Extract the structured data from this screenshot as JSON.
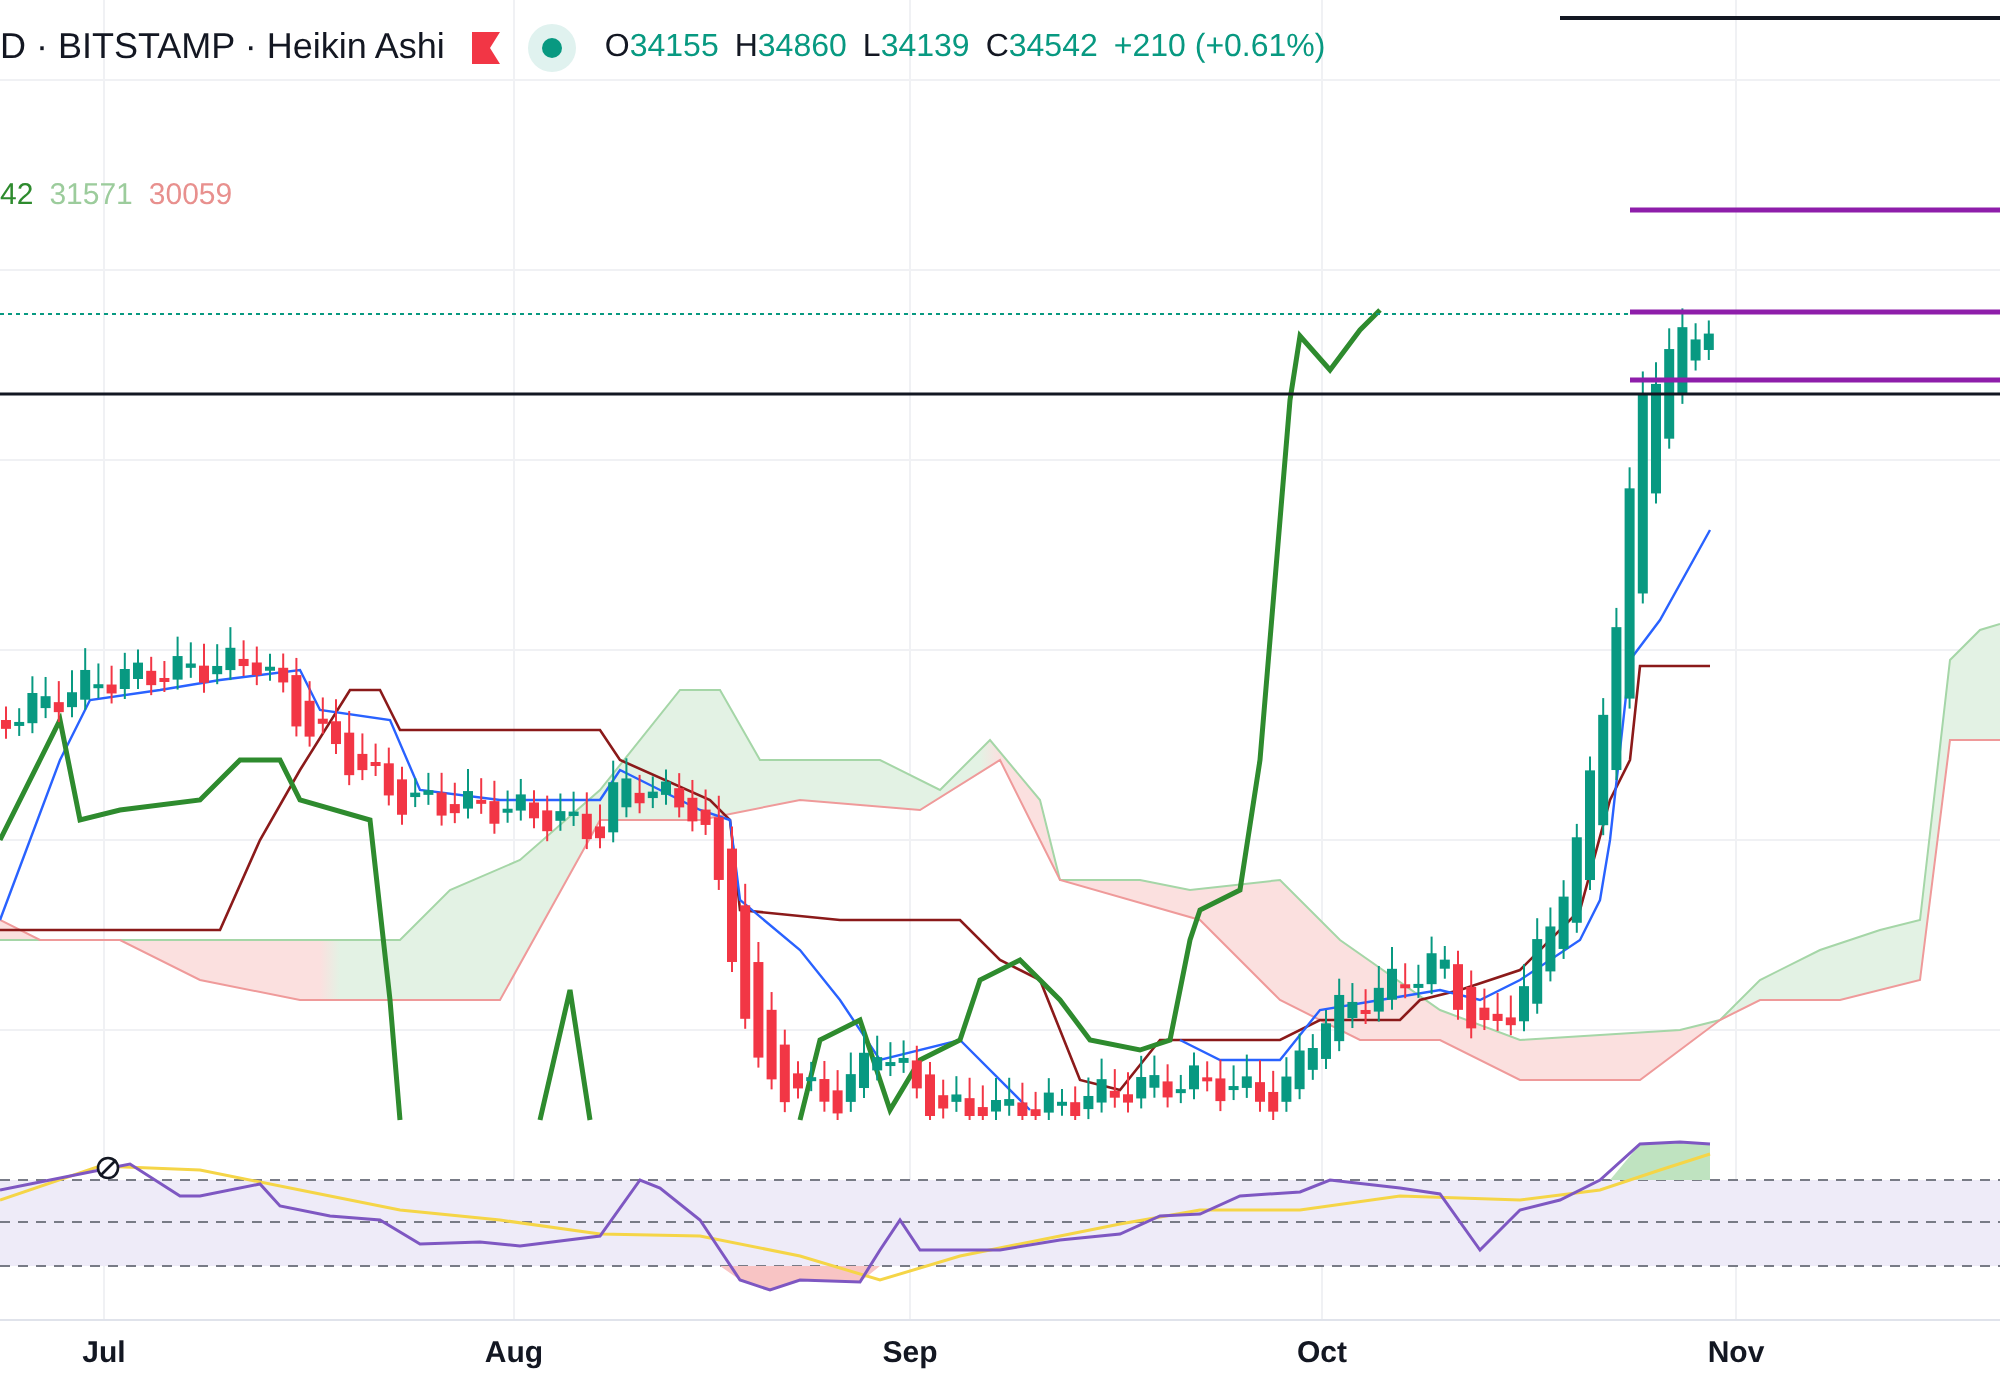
{
  "header": {
    "title": "D · BITSTAMP · Heikin Ashi",
    "ohlc": [
      {
        "label": "O",
        "value": "34155"
      },
      {
        "label": "H",
        "value": "34860"
      },
      {
        "label": "L",
        "value": "34139"
      },
      {
        "label": "C",
        "value": "34542"
      }
    ],
    "change": "+210 (+0.61%)"
  },
  "indicator_legend": [
    {
      "value": "42",
      "color": "#2e8b2e"
    },
    {
      "value": "31571",
      "color": "#9ccc9c"
    },
    {
      "value": "30059",
      "color": "#e8908e"
    }
  ],
  "x_axis": {
    "labels": [
      "Jul",
      "Aug",
      "Sep",
      "Oct",
      "Nov"
    ]
  }
}
